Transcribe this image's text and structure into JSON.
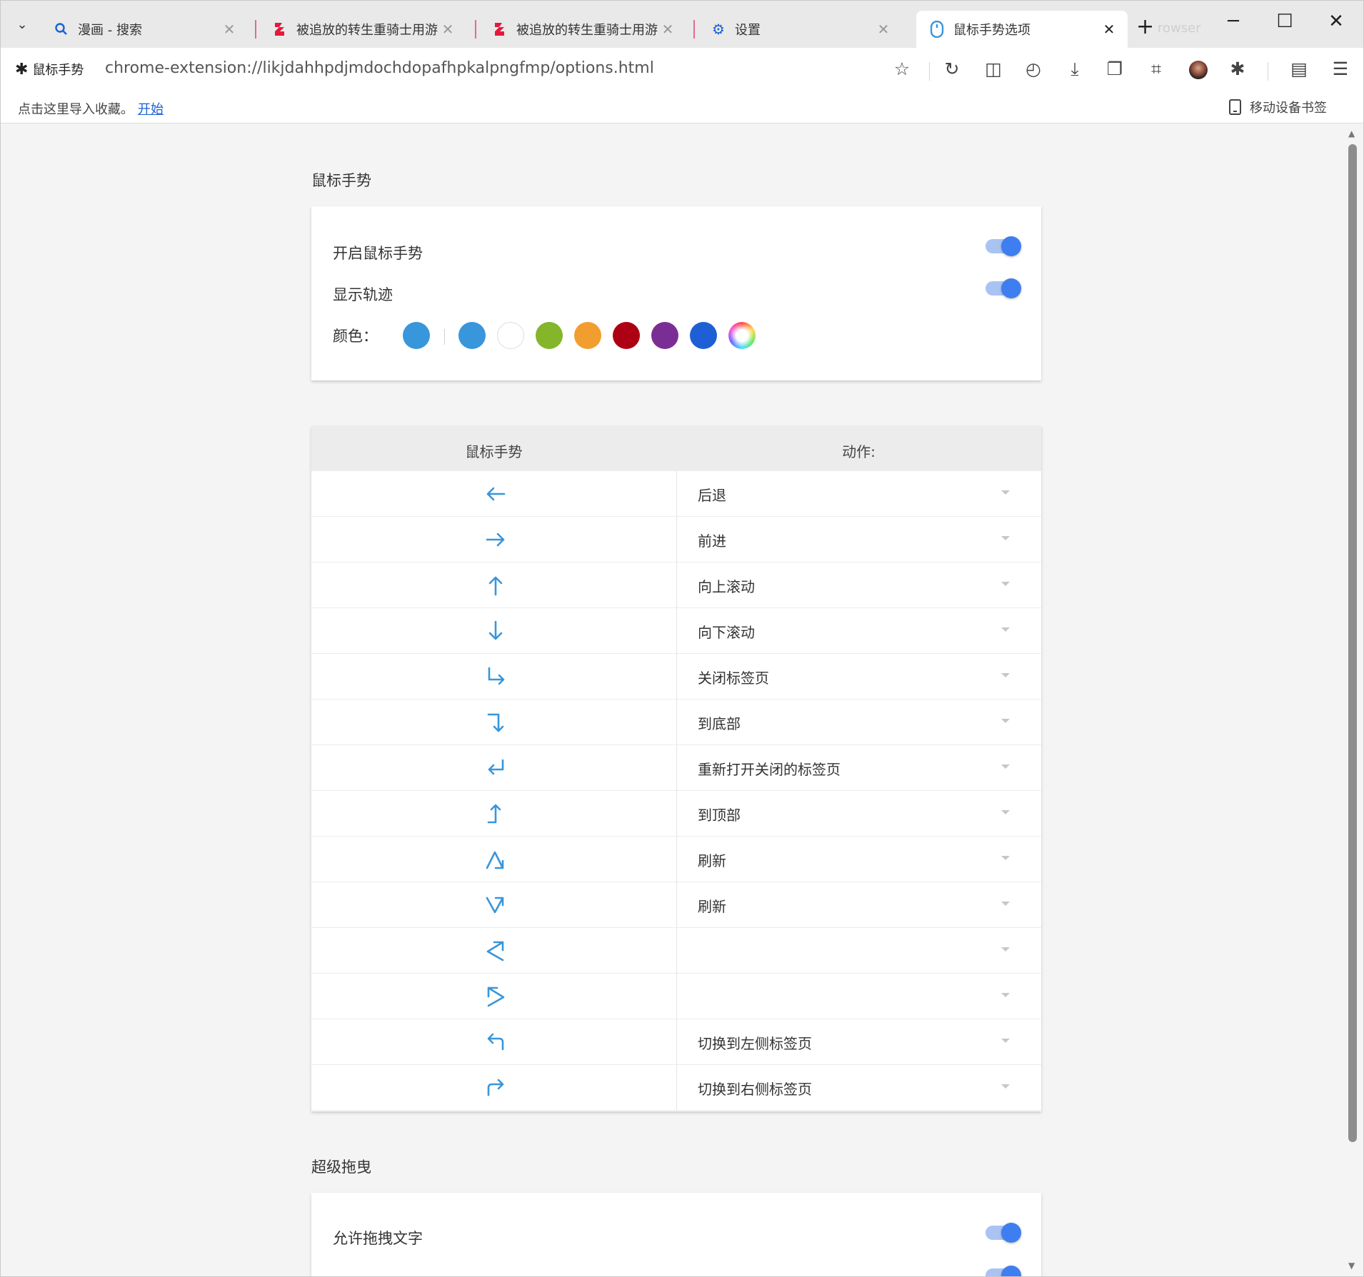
{
  "browser": {
    "tabs": [
      {
        "title": "漫画 - 搜索",
        "icon": "search-icon",
        "active": false
      },
      {
        "title": "被追放的转生重骑士用游",
        "icon": "manga-site-icon",
        "active": false
      },
      {
        "title": "被追放的转生重骑士用游",
        "icon": "manga-site-icon",
        "active": false
      },
      {
        "title": "设置",
        "icon": "gear-icon",
        "active": false
      },
      {
        "title": "鼠标手势选项",
        "icon": "mouse-icon",
        "active": true
      }
    ],
    "ghost_text": "rowser",
    "extension_label": "鼠标手势",
    "url": "chrome-extension://likjdahhpdjmdochdopafhpkalpngfmp/options.html",
    "bookmarks_bar": {
      "import_text": "点击这里导入收藏。",
      "start_link": "开始",
      "mobile_bookmarks": "移动设备书签"
    }
  },
  "options": {
    "gestures_section_title": "鼠标手势",
    "enable_gestures_label": "开启鼠标手势",
    "enable_gestures_on": true,
    "show_trail_label": "显示轨迹",
    "show_trail_on": true,
    "color_label": "颜色：",
    "current_color": "#3896db",
    "colors": [
      "#3896db",
      "#ffffff",
      "#84b52a",
      "#f29d2f",
      "#ae0013",
      "#7b2d96",
      "#1e5fd5",
      "rainbow"
    ],
    "table_headers": {
      "gesture": "鼠标手势",
      "action": "动作:"
    },
    "gestures": [
      {
        "icon": "arrow-left-icon",
        "action": "后退"
      },
      {
        "icon": "arrow-right-icon",
        "action": "前进"
      },
      {
        "icon": "arrow-up-icon",
        "action": "向上滚动"
      },
      {
        "icon": "arrow-down-icon",
        "action": "向下滚动"
      },
      {
        "icon": "arrow-down-right-icon",
        "action": "关闭标签页"
      },
      {
        "icon": "arrow-right-down-icon",
        "action": "到底部"
      },
      {
        "icon": "arrow-up-left-icon",
        "action": "重新打开关闭的标签页"
      },
      {
        "icon": "arrow-right-up-icon",
        "action": "到顶部"
      },
      {
        "icon": "arrow-up-down-icon",
        "action": "刷新"
      },
      {
        "icon": "arrow-down-up-icon",
        "action": "刷新"
      },
      {
        "icon": "arrow-zigzag-icon",
        "action": ""
      },
      {
        "icon": "arrow-zigzag-reverse-icon",
        "action": ""
      },
      {
        "icon": "arrow-up-left-curved-icon",
        "action": "切换到左侧标签页"
      },
      {
        "icon": "arrow-up-right-curved-icon",
        "action": "切换到右侧标签页"
      }
    ],
    "superdrag_section_title": "超级拖曳",
    "allow_drag_text_label": "允许拖拽文字",
    "allow_drag_text_on": true,
    "allow_drag_link_on": true
  }
}
